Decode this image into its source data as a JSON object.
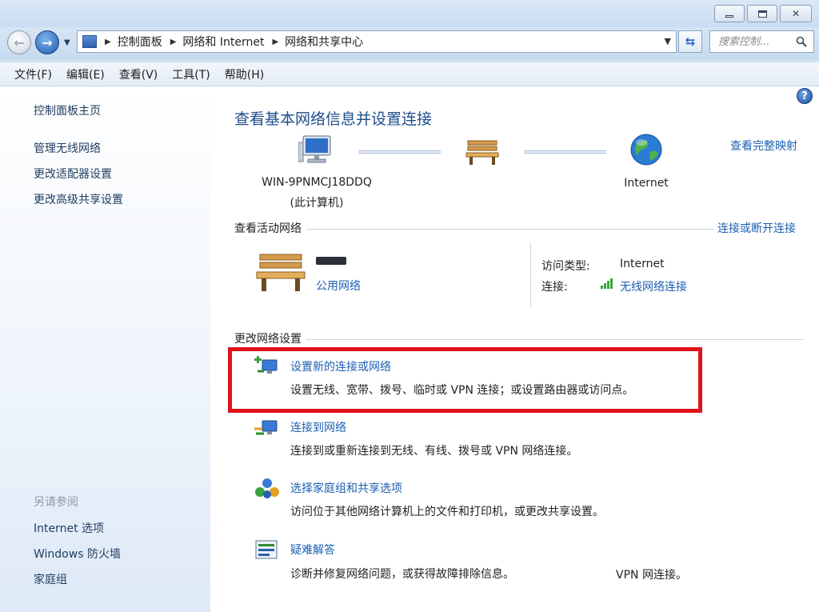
{
  "address": {
    "crumbs": [
      "控制面板",
      "网络和 Internet",
      "网络和共享中心"
    ]
  },
  "search": {
    "placeholder": "搜索控制..."
  },
  "menu": [
    "文件(F)",
    "编辑(E)",
    "查看(V)",
    "工具(T)",
    "帮助(H)"
  ],
  "sidebar": {
    "home": "控制面板主页",
    "links": [
      "管理无线网络",
      "更改适配器设置",
      "更改高级共享设置"
    ],
    "see_also_title": "另请参阅",
    "see_also": [
      "Internet 选项",
      "Windows 防火墙",
      "家庭组"
    ]
  },
  "main": {
    "title": "查看基本网络信息并设置连接",
    "full_map": "查看完整映射",
    "map": {
      "computer_name": "WIN-9PNMCJ18DDQ",
      "computer_sub": "(此计算机)",
      "internet": "Internet"
    },
    "active": {
      "section_title": "查看活动网络",
      "connect_link": "连接或断开连接",
      "network_type": "公用网络",
      "access_label": "访问类型:",
      "access_value": "Internet",
      "conn_label": "连接:",
      "conn_value": "无线网络连接"
    },
    "change": {
      "section_title": "更改网络设置",
      "tasks": [
        {
          "title": "设置新的连接或网络",
          "desc": "设置无线、宽带、拨号、临时或 VPN 连接；或设置路由器或访问点。"
        },
        {
          "title": "连接到网络",
          "desc": "连接到或重新连接到无线、有线、拨号或 VPN 网络连接。"
        },
        {
          "title": "选择家庭组和共享选项",
          "desc": "访问位于其他网络计算机上的文件和打印机，或更改共享设置。"
        },
        {
          "title": "疑难解答",
          "desc": "诊断并修复网络问题，或获得故障排除信息。"
        }
      ],
      "stray": "VPN 网连接。"
    }
  },
  "colors": {
    "link": "#1c5fb0",
    "title": "#1e4e8c",
    "highlight": "#e0131a"
  }
}
